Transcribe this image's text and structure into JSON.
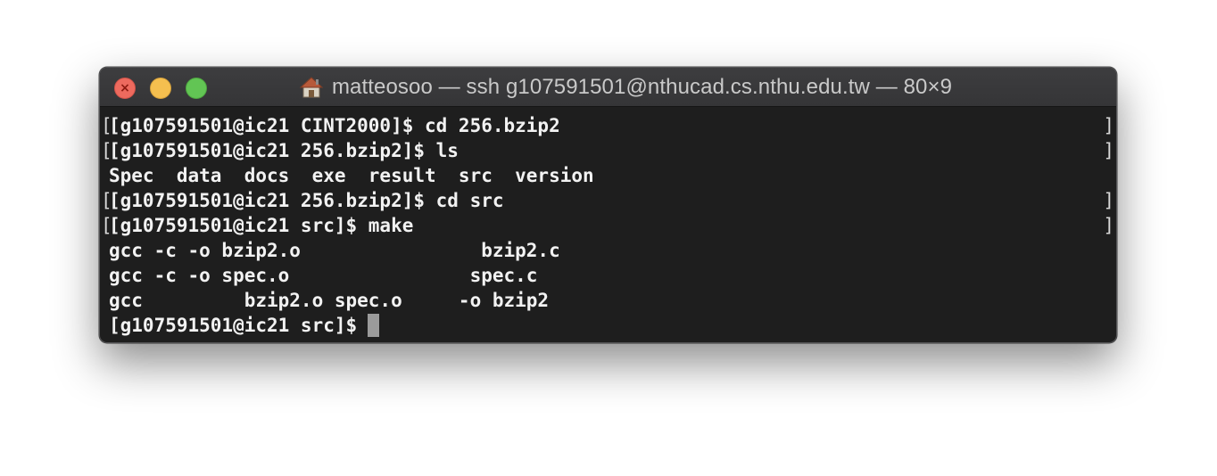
{
  "window": {
    "title": "matteosoo — ssh g107591501@nthucad.cs.nthu.edu.tw — 80×9",
    "title_icon": "home-icon",
    "controls": [
      "close",
      "minimize",
      "zoom"
    ]
  },
  "terminal": {
    "lines": [
      {
        "text": "[g107591501@ic21 CINT2000]$ cd 256.bzip2",
        "marked": true
      },
      {
        "text": "[g107591501@ic21 256.bzip2]$ ls",
        "marked": true
      },
      {
        "text": "Spec  data  docs  exe  result  src  version",
        "marked": false
      },
      {
        "text": "[g107591501@ic21 256.bzip2]$ cd src",
        "marked": true
      },
      {
        "text": "[g107591501@ic21 src]$ make",
        "marked": true
      },
      {
        "text": "gcc -c -o bzip2.o                bzip2.c",
        "marked": false
      },
      {
        "text": "gcc -c -o spec.o                spec.c",
        "marked": false
      },
      {
        "text": "gcc         bzip2.o spec.o     -o bzip2",
        "marked": false
      },
      {
        "text": "[g107591501@ic21 src]$",
        "marked": false
      }
    ],
    "mark_left": "[",
    "mark_right": "]"
  },
  "colors": {
    "background": "#1e1e1e",
    "text": "#f2f2f2",
    "cursor": "#9b9b9b",
    "close": "#ed6a5e",
    "minimize": "#f5bf4f",
    "zoom": "#62c554"
  }
}
